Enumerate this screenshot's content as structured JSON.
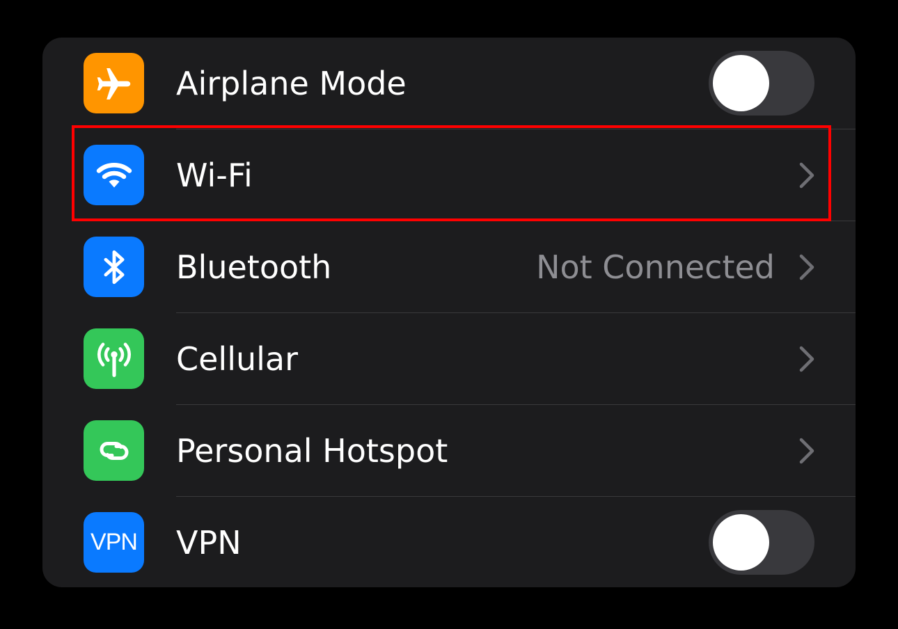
{
  "settings": {
    "rows": [
      {
        "label": "Airplane Mode",
        "icon": "airplane-icon",
        "icon_bg": "#ff9500",
        "control": "toggle",
        "toggle_on": false
      },
      {
        "label": "Wi-Fi",
        "icon": "wifi-icon",
        "icon_bg": "#0a7aff",
        "control": "chevron"
      },
      {
        "label": "Bluetooth",
        "icon": "bluetooth-icon",
        "icon_bg": "#0a7aff",
        "control": "chevron",
        "value": "Not Connected"
      },
      {
        "label": "Cellular",
        "icon": "antenna-icon",
        "icon_bg": "#34c759",
        "control": "chevron"
      },
      {
        "label": "Personal Hotspot",
        "icon": "link-icon",
        "icon_bg": "#34c759",
        "control": "chevron"
      },
      {
        "label": "VPN",
        "icon": "vpn-icon",
        "icon_bg": "#0a7aff",
        "icon_text": "VPN",
        "control": "toggle",
        "toggle_on": false
      }
    ]
  },
  "highlight": {
    "target": "Wi-Fi",
    "color": "#ff0000"
  },
  "colors": {
    "background": "#000000",
    "panel": "#1c1c1e",
    "separator": "#3a3a3c",
    "secondary_text": "#8e8e93",
    "toggle_off": "#39393d"
  }
}
